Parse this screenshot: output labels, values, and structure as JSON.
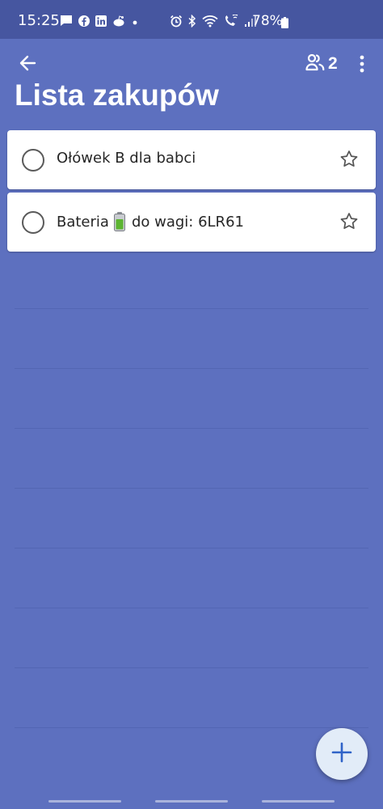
{
  "status_bar": {
    "time": "15:25",
    "battery_percent": "78%",
    "notification_icons": [
      "message-icon",
      "facebook-icon",
      "linkedin-icon",
      "reddit-icon",
      "dot-icon"
    ],
    "system_icons": [
      "alarm-icon",
      "bluetooth-icon",
      "wifi-icon",
      "wifi-call-icon",
      "signal-icon",
      "battery-icon"
    ]
  },
  "toolbar": {
    "back_icon": "arrow-left-icon",
    "collaborators_icon": "people-icon",
    "collaborators_count": "2",
    "more_icon": "more-vertical-icon"
  },
  "list": {
    "title": "Lista zakupów",
    "tasks": [
      {
        "title": "Ołówek B dla babci",
        "completed": false,
        "starred": false
      },
      {
        "title_before": "Bateria",
        "emoji": "battery-emoji-icon",
        "title_after": "do wagi: 6LR61",
        "completed": false,
        "starred": false
      }
    ]
  },
  "fab": {
    "icon": "plus-icon"
  },
  "colors": {
    "background": "#5d70bf",
    "status_bar": "#4656a0",
    "card": "#ffffff",
    "fab": "#e2ecf8",
    "accent": "#2f63c8"
  }
}
